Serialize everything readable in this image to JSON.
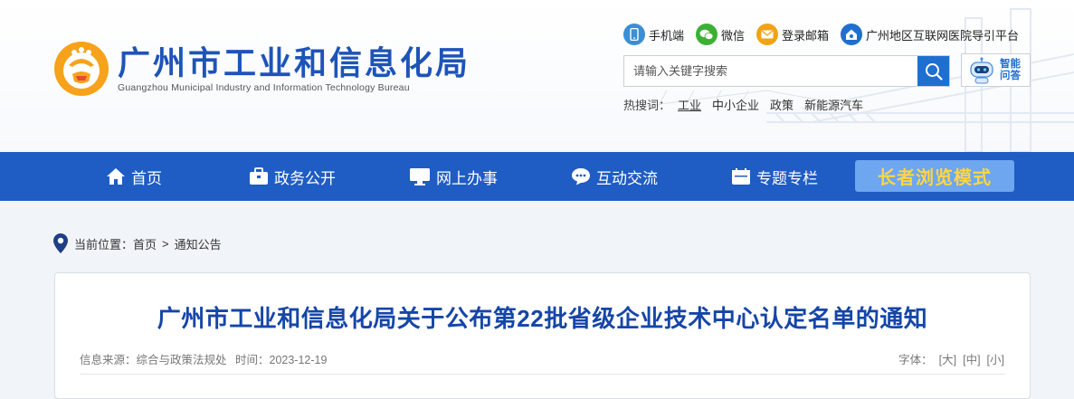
{
  "header": {
    "logo_cn": "广州市工业和信息化局",
    "logo_en": "Guangzhou Municipal Industry and Information Technology Bureau",
    "toplinks": [
      {
        "label": "手机端",
        "icon": "mobile-icon",
        "color": "#3b8fd6"
      },
      {
        "label": "微信",
        "icon": "wechat-icon",
        "color": "#3cb035"
      },
      {
        "label": "登录邮箱",
        "icon": "mail-icon",
        "color": "#f0a315"
      },
      {
        "label": "广州地区互联网医院导引平台",
        "icon": "hospital-icon",
        "color": "#1e6fd0"
      }
    ],
    "search": {
      "placeholder": "请输入关键字搜索"
    },
    "robot_label": "智能问答",
    "hot": {
      "label": "热搜词：",
      "keywords": [
        "工业",
        "中小企业",
        "政策",
        "新能源汽车"
      ]
    }
  },
  "nav": {
    "items": [
      {
        "label": "首页",
        "icon": "home-icon"
      },
      {
        "label": "政务公开",
        "icon": "briefcase-icon"
      },
      {
        "label": "网上办事",
        "icon": "monitor-icon"
      },
      {
        "label": "互动交流",
        "icon": "chat-icon"
      },
      {
        "label": "专题专栏",
        "icon": "calendar-icon"
      }
    ],
    "elder_mode": "长者浏览模式"
  },
  "breadcrumb": {
    "prefix": "当前位置：",
    "items": [
      "首页",
      "通知公告"
    ],
    "separator": ">"
  },
  "article": {
    "title": "广州市工业和信息化局关于公布第22批省级企业技术中心认定名单的通知",
    "source": "信息来源：综合与政策法规处",
    "time": "时间：2023-12-19",
    "font_label": "字体：",
    "font_sizes": [
      "[大]",
      "[中]",
      "[小]"
    ]
  },
  "colors": {
    "brand_blue": "#1f5cc4",
    "title_blue": "#1546a8",
    "elder_text": "#ffd640"
  }
}
